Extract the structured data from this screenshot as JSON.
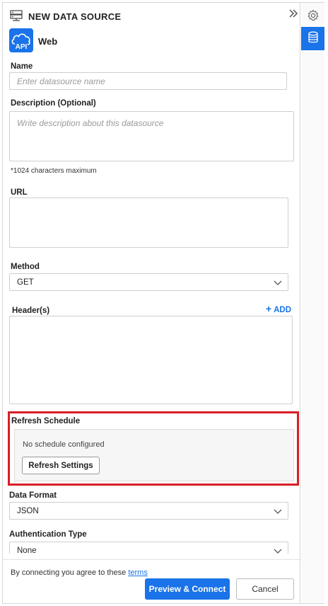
{
  "panel": {
    "title": "NEW DATA SOURCE",
    "collapse_icon": "double-chevron-right-icon",
    "header_icon": "data-source-icon"
  },
  "source": {
    "logo_text": "API",
    "name": "Web"
  },
  "form": {
    "name": {
      "label": "Name",
      "placeholder": "Enter datasource name",
      "value": ""
    },
    "description": {
      "label": "Description (Optional)",
      "placeholder": "Write description about this datasource",
      "value": "",
      "hint": "*1024 characters maximum"
    },
    "url": {
      "label": "URL",
      "value": ""
    },
    "method": {
      "label": "Method",
      "value": "GET"
    },
    "headers": {
      "label": "Header(s)",
      "add_label": "ADD",
      "add_icon": "+"
    },
    "refresh": {
      "label": "Refresh Schedule",
      "status": "No schedule configured",
      "button": "Refresh Settings"
    },
    "data_format": {
      "label": "Data Format",
      "value": "JSON"
    },
    "auth_type": {
      "label": "Authentication Type",
      "value": "None"
    }
  },
  "footer": {
    "agree_text": "By connecting you agree to these",
    "terms_link": "terms",
    "primary_button": "Preview & Connect",
    "cancel_button": "Cancel"
  },
  "rail": {
    "items": [
      {
        "icon": "gear-icon",
        "active": false
      },
      {
        "icon": "database-icon",
        "active": true
      }
    ]
  },
  "colors": {
    "accent": "#1a73e8",
    "highlight": "#d71f26"
  }
}
